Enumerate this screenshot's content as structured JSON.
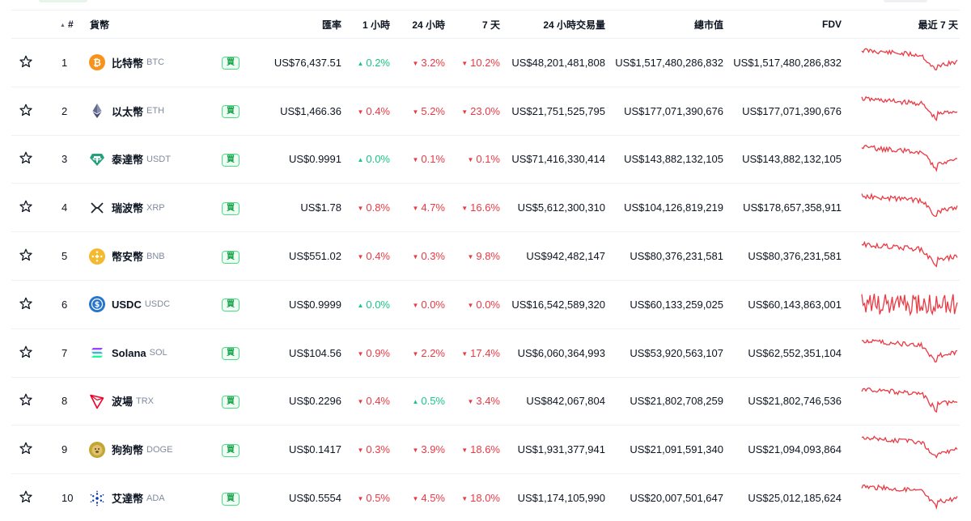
{
  "header": {
    "rank": "#",
    "coin": "貨幣",
    "price": "匯率",
    "h1": "1 小時",
    "h24": "24 小時",
    "d7": "7 天",
    "volume": "24 小時交易量",
    "market_cap": "總市值",
    "fdv": "FDV",
    "last7": "最近 7 天"
  },
  "buy_label": "買",
  "colors": {
    "up": "#16c784",
    "down": "#ea3943",
    "sparkline": "#ea3943",
    "buy": "#16a34a"
  },
  "coins": [
    {
      "rank": "1",
      "name": "比特幣",
      "symbol": "BTC",
      "icon": "bitcoin-icon",
      "price": "US$76,437.51",
      "h1": "0.2%",
      "h1_dir": "up",
      "h24": "3.2%",
      "h24_dir": "down",
      "d7": "10.2%",
      "d7_dir": "down",
      "volume": "US$48,201,481,808",
      "market_cap": "US$1,517,480,286,832",
      "fdv": "US$1,517,480,286,832"
    },
    {
      "rank": "2",
      "name": "以太幣",
      "symbol": "ETH",
      "icon": "ethereum-icon",
      "price": "US$1,466.36",
      "h1": "0.4%",
      "h1_dir": "down",
      "h24": "5.2%",
      "h24_dir": "down",
      "d7": "23.0%",
      "d7_dir": "down",
      "volume": "US$21,751,525,795",
      "market_cap": "US$177,071,390,676",
      "fdv": "US$177,071,390,676"
    },
    {
      "rank": "3",
      "name": "泰達幣",
      "symbol": "USDT",
      "icon": "tether-icon",
      "price": "US$0.9991",
      "h1": "0.0%",
      "h1_dir": "up",
      "h24": "0.1%",
      "h24_dir": "down",
      "d7": "0.1%",
      "d7_dir": "down",
      "volume": "US$71,416,330,414",
      "market_cap": "US$143,882,132,105",
      "fdv": "US$143,882,132,105"
    },
    {
      "rank": "4",
      "name": "瑞波幣",
      "symbol": "XRP",
      "icon": "xrp-icon",
      "price": "US$1.78",
      "h1": "0.8%",
      "h1_dir": "down",
      "h24": "4.7%",
      "h24_dir": "down",
      "d7": "16.6%",
      "d7_dir": "down",
      "volume": "US$5,612,300,310",
      "market_cap": "US$104,126,819,219",
      "fdv": "US$178,657,358,911"
    },
    {
      "rank": "5",
      "name": "幣安幣",
      "symbol": "BNB",
      "icon": "bnb-icon",
      "price": "US$551.02",
      "h1": "0.4%",
      "h1_dir": "down",
      "h24": "0.3%",
      "h24_dir": "down",
      "d7": "9.8%",
      "d7_dir": "down",
      "volume": "US$942,482,147",
      "market_cap": "US$80,376,231,581",
      "fdv": "US$80,376,231,581"
    },
    {
      "rank": "6",
      "name": "USDC",
      "symbol": "USDC",
      "icon": "usdc-icon",
      "price": "US$0.9999",
      "h1": "0.0%",
      "h1_dir": "up",
      "h24": "0.0%",
      "h24_dir": "down",
      "d7": "0.0%",
      "d7_dir": "down",
      "volume": "US$16,542,589,320",
      "market_cap": "US$60,133,259,025",
      "fdv": "US$60,143,863,001"
    },
    {
      "rank": "7",
      "name": "Solana",
      "symbol": "SOL",
      "icon": "solana-icon",
      "price": "US$104.56",
      "h1": "0.9%",
      "h1_dir": "down",
      "h24": "2.2%",
      "h24_dir": "down",
      "d7": "17.4%",
      "d7_dir": "down",
      "volume": "US$6,060,364,993",
      "market_cap": "US$53,920,563,107",
      "fdv": "US$62,552,351,104"
    },
    {
      "rank": "8",
      "name": "波場",
      "symbol": "TRX",
      "icon": "tron-icon",
      "price": "US$0.2296",
      "h1": "0.4%",
      "h1_dir": "down",
      "h24": "0.5%",
      "h24_dir": "up",
      "d7": "3.4%",
      "d7_dir": "down",
      "volume": "US$842,067,804",
      "market_cap": "US$21,802,708,259",
      "fdv": "US$21,802,746,536"
    },
    {
      "rank": "9",
      "name": "狗狗幣",
      "symbol": "DOGE",
      "icon": "dogecoin-icon",
      "price": "US$0.1417",
      "h1": "0.3%",
      "h1_dir": "down",
      "h24": "3.9%",
      "h24_dir": "down",
      "d7": "18.6%",
      "d7_dir": "down",
      "volume": "US$1,931,377,941",
      "market_cap": "US$21,091,591,340",
      "fdv": "US$21,094,093,864"
    },
    {
      "rank": "10",
      "name": "艾達幣",
      "symbol": "ADA",
      "icon": "cardano-icon",
      "price": "US$0.5554",
      "h1": "0.5%",
      "h1_dir": "down",
      "h24": "4.5%",
      "h24_dir": "down",
      "d7": "18.0%",
      "d7_dir": "down",
      "volume": "US$1,174,105,990",
      "market_cap": "US$20,007,501,647",
      "fdv": "US$25,012,185,624"
    }
  ]
}
